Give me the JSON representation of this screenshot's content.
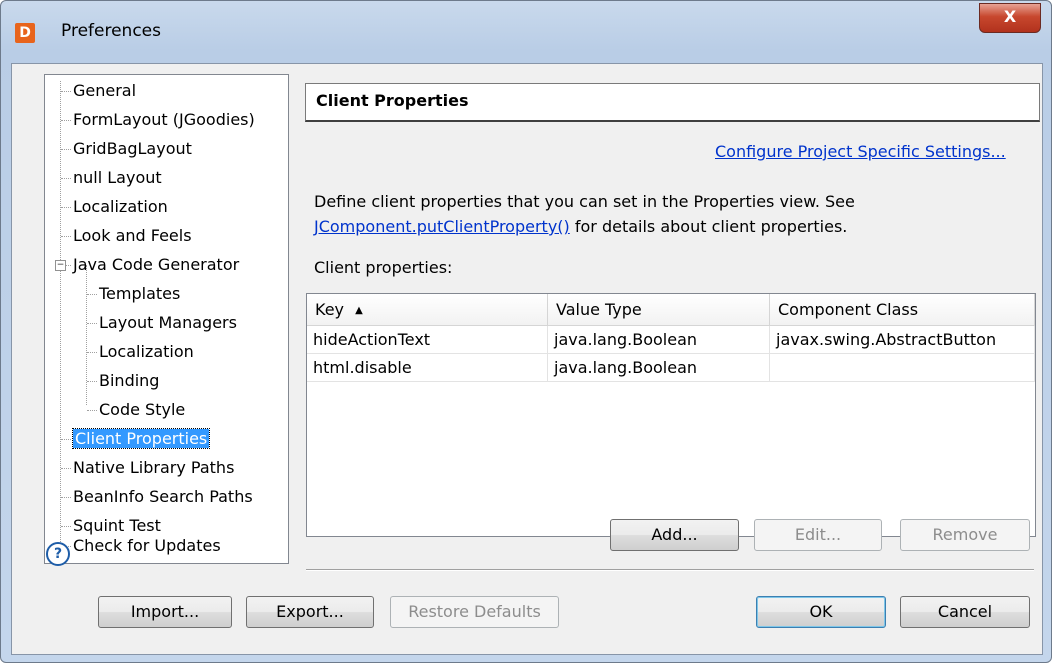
{
  "window": {
    "title": "Preferences",
    "app_icon_letter": "D",
    "close_label": "X"
  },
  "tree": {
    "items": [
      {
        "label": "General",
        "level": 0
      },
      {
        "label": "FormLayout (JGoodies)",
        "level": 0
      },
      {
        "label": "GridBagLayout",
        "level": 0
      },
      {
        "label": "null Layout",
        "level": 0
      },
      {
        "label": "Localization",
        "level": 0
      },
      {
        "label": "Look and Feels",
        "level": 0
      },
      {
        "label": "Java Code Generator",
        "level": 0,
        "expanded": true
      },
      {
        "label": "Templates",
        "level": 1
      },
      {
        "label": "Layout Managers",
        "level": 1
      },
      {
        "label": "Localization",
        "level": 1
      },
      {
        "label": "Binding",
        "level": 1
      },
      {
        "label": "Code Style",
        "level": 1
      },
      {
        "label": "Client Properties",
        "level": 0,
        "selected": true
      },
      {
        "label": "Native Library Paths",
        "level": 0
      },
      {
        "label": "BeanInfo Search Paths",
        "level": 0
      },
      {
        "label": "Squint Test",
        "level": 0
      },
      {
        "label": "Check for Updates",
        "level": 0
      }
    ],
    "expander_symbol": "−"
  },
  "page": {
    "header": "Client Properties",
    "configure_link": "Configure Project Specific Settings...",
    "description_line1": "Define client properties that you can set in the Properties view. See",
    "description_link": "JComponent.putClientProperty()",
    "description_rest": " for details about client properties.",
    "client_properties_label": "Client properties:"
  },
  "table": {
    "columns": [
      {
        "label": "Key",
        "sort": "▲"
      },
      {
        "label": "Value Type"
      },
      {
        "label": "Component Class"
      }
    ],
    "rows": [
      [
        "hideActionText",
        "java.lang.Boolean",
        "javax.swing.AbstractButton"
      ],
      [
        "html.disable",
        "java.lang.Boolean",
        ""
      ]
    ]
  },
  "buttons": {
    "add": "Add...",
    "edit": "Edit...",
    "remove": "Remove",
    "help": "?",
    "import": "Import...",
    "export": "Export...",
    "restore_defaults": "Restore Defaults",
    "ok": "OK",
    "cancel": "Cancel"
  },
  "colors": {
    "selection": "#3399ff",
    "link": "#0033cc",
    "app_icon": "#e8641c",
    "close_button": "#c7472e"
  }
}
